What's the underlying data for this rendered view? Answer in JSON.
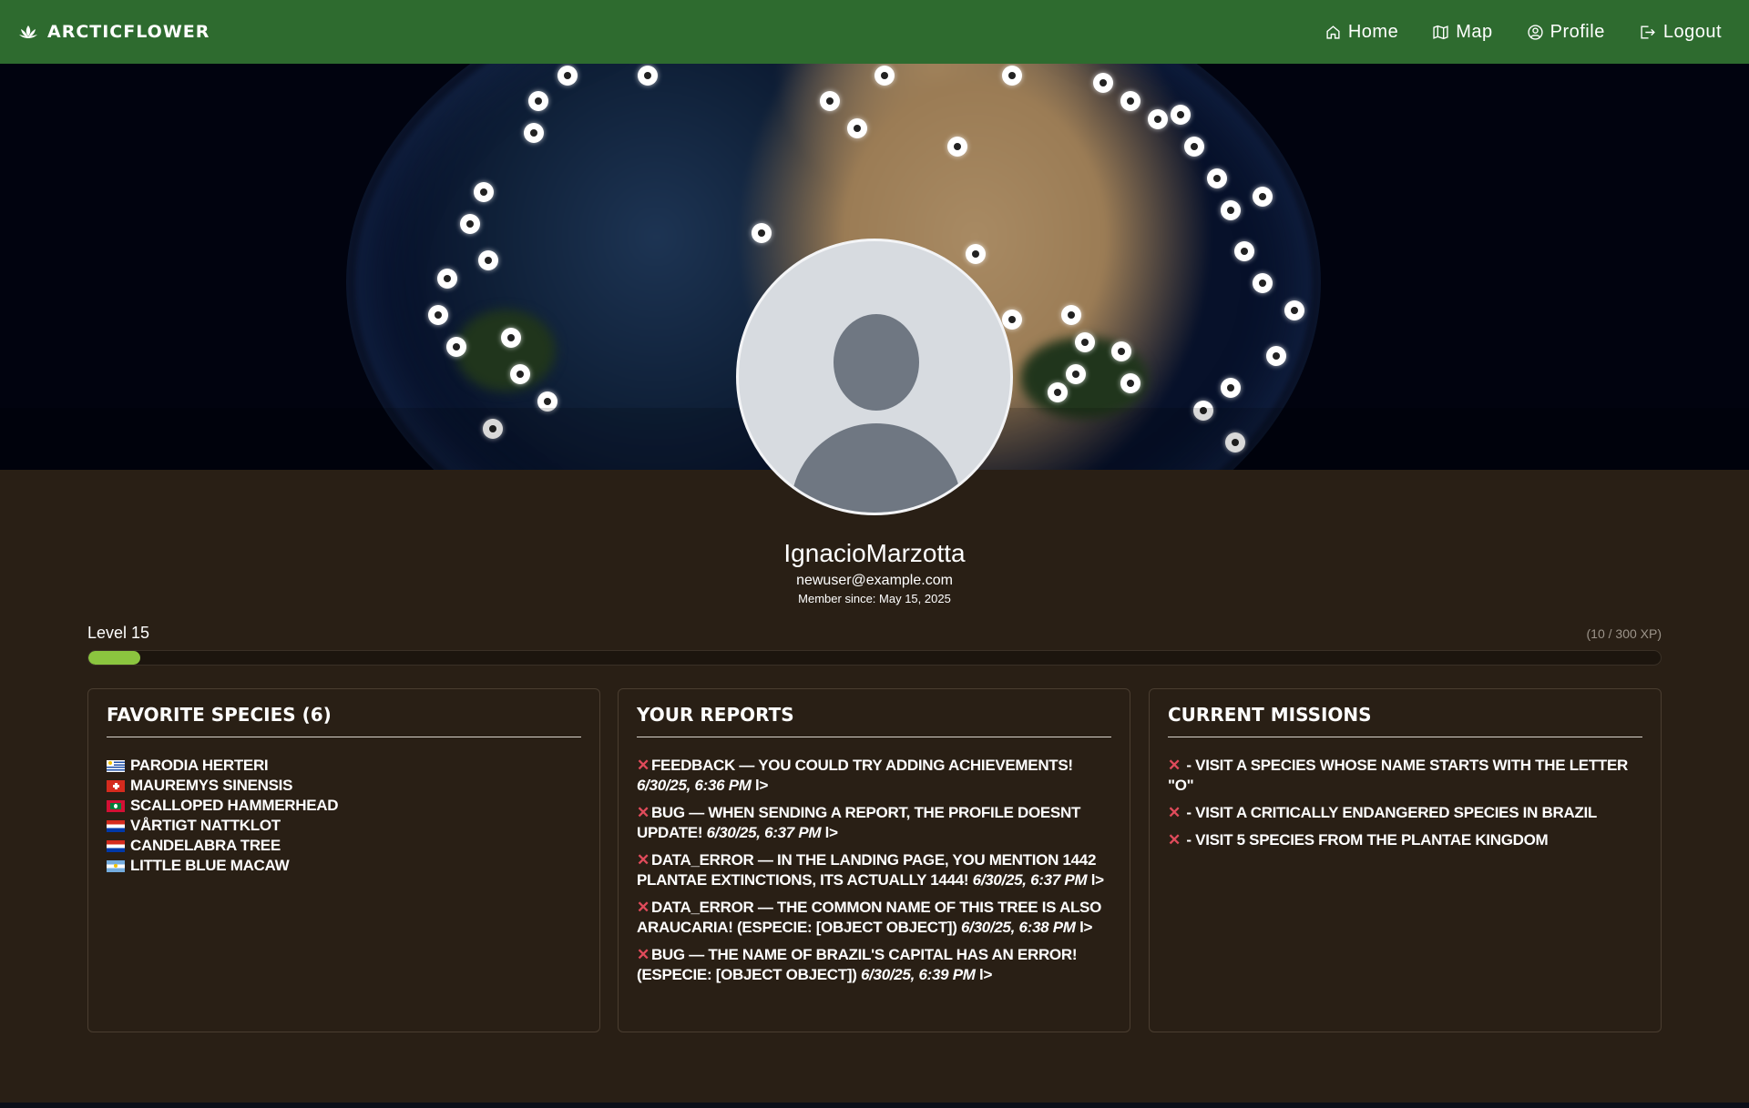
{
  "navbar": {
    "brand": "ARCTICFLOWER",
    "brand_icon": "lotus-icon",
    "links": [
      {
        "label": "Home",
        "icon": "home-icon"
      },
      {
        "label": "Map",
        "icon": "map-icon"
      },
      {
        "label": "Profile",
        "icon": "user-circle-icon"
      },
      {
        "label": "Logout",
        "icon": "logout-icon"
      }
    ]
  },
  "profile": {
    "username": "IgnacioMarzotta",
    "email": "newuser@example.com",
    "member_since": "Member since: May 15, 2025"
  },
  "level": {
    "label": "Level 15",
    "xp_text": "(10 / 300 XP)",
    "progress_fraction": 0.0333
  },
  "favorites": {
    "title": "FAVORITE SPECIES (6)",
    "items": [
      {
        "name": "PARODIA HERTERI",
        "flag": "uruguay"
      },
      {
        "name": "MAUREMYS SINENSIS",
        "flag": "switzerland"
      },
      {
        "name": "SCALLOPED HAMMERHEAD",
        "flag": "maldives"
      },
      {
        "name": "VÅRTIGT NATTKLOT",
        "flag": "paraguay"
      },
      {
        "name": "CANDELABRA TREE",
        "flag": "paraguay"
      },
      {
        "name": "LITTLE BLUE MACAW",
        "flag": "argentina"
      }
    ]
  },
  "reports": {
    "title": "YOUR REPORTS",
    "items": [
      {
        "type": "FEEDBACK",
        "text": " — YOU COULD TRY ADDING ACHIEVEMENTS! ",
        "date": "6/30/25, 6:36 PM",
        "tail": " l>"
      },
      {
        "type": "BUG",
        "text": " — WHEN SENDING A REPORT, THE PROFILE DOESNT UPDATE! ",
        "date": "6/30/25, 6:37 PM",
        "tail": " l>"
      },
      {
        "type": "DATA_ERROR",
        "text": " — IN THE LANDING PAGE, YOU MENTION 1442 PLANTAE EXTINCTIONS, ITS ACTUALLY 1444! ",
        "date": "6/30/25, 6:37 PM",
        "tail": " l>"
      },
      {
        "type": "DATA_ERROR",
        "text": " — THE COMMON NAME OF THIS TREE IS ALSO ARAUCARIA! (ESPECIE: [OBJECT OBJECT]) ",
        "date": "6/30/25, 6:38 PM",
        "tail": " l>"
      },
      {
        "type": "BUG",
        "text": " — THE NAME OF BRAZIL'S CAPITAL HAS AN ERROR! (ESPECIE: [OBJECT OBJECT]) ",
        "date": "6/30/25, 6:39 PM",
        "tail": " l>"
      }
    ]
  },
  "missions": {
    "title": "CURRENT MISSIONS",
    "items": [
      {
        "text": " - VISIT A SPECIES WHOSE NAME STARTS WITH THE LETTER \"O\""
      },
      {
        "text": " - VISIT A CRITICALLY ENDANGERED SPECIES IN BRAZIL"
      },
      {
        "text": " - VISIT 5 SPECIES FROM THE PLANTAE KINGDOM"
      }
    ]
  },
  "status_mark": "✕",
  "colors": {
    "navbar": "#2e6b2f",
    "background": "#291f15",
    "xp_fill": "#8bc53f",
    "x_mark": "#e04b5b"
  }
}
